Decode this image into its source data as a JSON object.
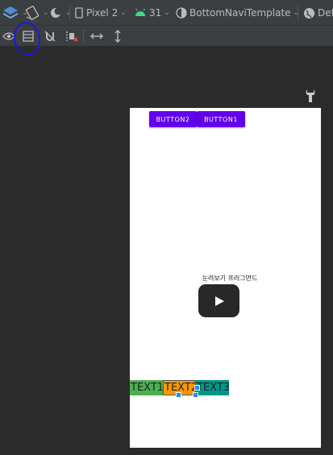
{
  "toolbar": {
    "device": "Pixel 2",
    "api": "31",
    "theme": "BottomNaviTemplate",
    "locale_partial": "Def"
  },
  "preview": {
    "button2_label": "BUTTON2",
    "button1_label": "BUTTON1",
    "video_label": "눈려보기 프러그먼드",
    "tab1_label": "TEXT1",
    "tab2_label": "TEXT2",
    "tab3_label": "TEXT3"
  },
  "colors": {
    "button_purple": "#6200ee",
    "tab_green": "#4caf50",
    "tab_orange": "#ff9800",
    "tab_teal": "#009688",
    "selection_blue": "#2a8af0",
    "annotation_blue": "#1a1adb"
  }
}
